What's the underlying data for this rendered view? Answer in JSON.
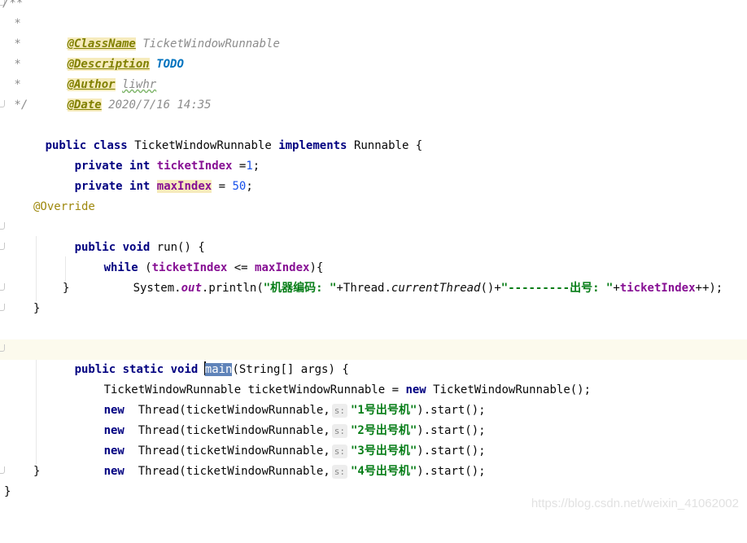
{
  "doc": {
    "open": "/**",
    "star": " * ",
    "close": " */",
    "tags": [
      {
        "tag": "@ClassName",
        "value": "TicketWindowRunnable"
      },
      {
        "tag": "@Description",
        "value": "TODO"
      },
      {
        "tag": "@Author",
        "value": "liwhr"
      },
      {
        "tag": "@Date",
        "value": "2020/7/16 14:35"
      }
    ]
  },
  "code": {
    "public": "public",
    "class": "class",
    "private": "private",
    "static": "static",
    "void": "void",
    "int": "int",
    "implements": "implements",
    "while": "while",
    "new": "new",
    "class_name": "TicketWindowRunnable",
    "interface_name": "Runnable",
    "field1": "ticketIndex",
    "field1_init": " =",
    "field1_value": "1",
    "field2": "maxIndex",
    "field2_init": " = ",
    "field2_value": "50",
    "annotation": "@Override",
    "run": " run() {",
    "while_cond_open": " (",
    "le": " <= ",
    "while_cond_close": "){",
    "system": "System.",
    "out": "out",
    "println": ".println(",
    "str1": "\"机器编码: \"",
    "plus_thread": "+Thread.",
    "current_thread": "currentThread",
    "paren_plus": "()+",
    "str2": "\"---------出号: \"",
    "plus": "+",
    "incr_end": "++);",
    "close_brace": "}",
    "main": "main",
    "main_args": "(String[] args) {",
    "decl_type": "TicketWindowRunnable ticketWindowRunnable = ",
    "ctor_call": " TicketWindowRunnable();",
    "thread_call": "  Thread(ticketWindowRunnable,",
    "hint_label": "s:",
    "thread_names": [
      "\"1号出号机\"",
      "\"2号出号机\"",
      "\"3号出号机\"",
      "\"4号出号机\""
    ],
    "start_call": ").start();",
    "semi": ";"
  },
  "watermark": "https://blog.csdn.net/weixin_41062002"
}
